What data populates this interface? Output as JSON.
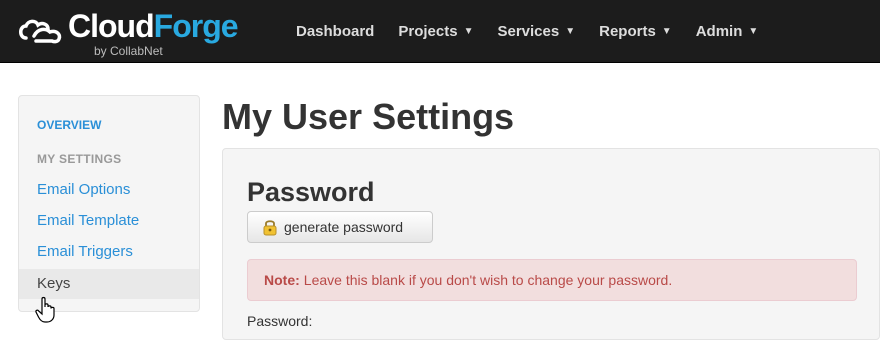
{
  "brand": {
    "name_part1": "Cloud",
    "name_part2": "Forge",
    "sub": "by CollabNet",
    "accent_color": "#29a9e0"
  },
  "nav": {
    "items": [
      {
        "label": "Dashboard"
      },
      {
        "label": "Projects",
        "dropdown_icon": "caret-down-icon"
      },
      {
        "label": "Services",
        "dropdown_icon": "caret-down-icon"
      },
      {
        "label": "Reports",
        "dropdown_icon": "caret-down-icon"
      },
      {
        "label": "Admin",
        "dropdown_icon": "caret-down-icon"
      }
    ]
  },
  "sidebar": {
    "overview": "OVERVIEW",
    "section_header": "MY SETTINGS",
    "items": [
      {
        "label": "Email Options"
      },
      {
        "label": "Email Template"
      },
      {
        "label": "Email Triggers"
      },
      {
        "label": "Keys",
        "active": true
      }
    ]
  },
  "main": {
    "title": "My User Settings",
    "section": {
      "title": "Password",
      "generate_button": "generate password",
      "alert_strong": "Note:",
      "alert_text": "Leave this blank if you don't wish to change your password.",
      "alert_color": "#b94a48",
      "field_label": "Password:"
    }
  }
}
